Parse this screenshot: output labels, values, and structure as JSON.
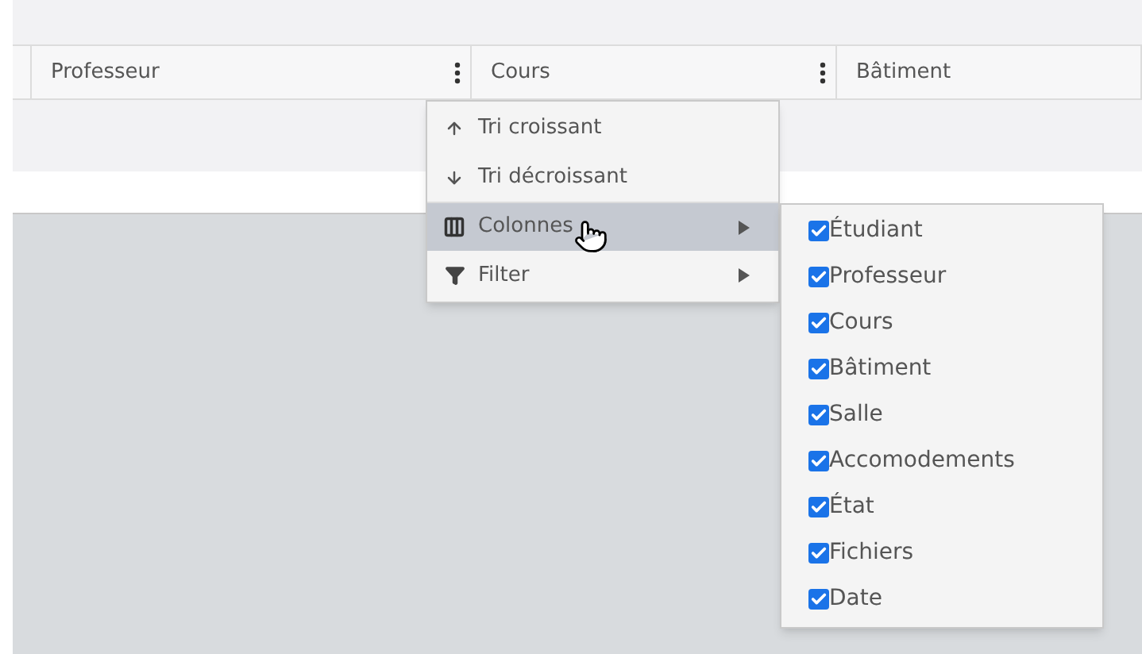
{
  "table": {
    "columns": [
      {
        "label": "Professeur"
      },
      {
        "label": "Cours"
      },
      {
        "label": "Bâtiment"
      }
    ]
  },
  "column_menu": {
    "items": [
      {
        "kind": "sort-asc",
        "label": "Tri croissant",
        "selected": false,
        "submenu": false
      },
      {
        "kind": "sort-desc",
        "label": "Tri décroissant",
        "selected": false,
        "submenu": false
      },
      {
        "kind": "columns",
        "label": "Colonnes",
        "selected": true,
        "submenu": true
      },
      {
        "kind": "filter",
        "label": "Filter",
        "selected": false,
        "submenu": true
      }
    ]
  },
  "columns_submenu": {
    "items": [
      {
        "label": "Étudiant",
        "checked": true
      },
      {
        "label": "Professeur",
        "checked": true
      },
      {
        "label": "Cours",
        "checked": true
      },
      {
        "label": "Bâtiment",
        "checked": true
      },
      {
        "label": "Salle",
        "checked": true
      },
      {
        "label": "Accomodements",
        "checked": true
      },
      {
        "label": "État",
        "checked": true
      },
      {
        "label": "Fichiers",
        "checked": true
      },
      {
        "label": "Date",
        "checked": true
      }
    ]
  }
}
